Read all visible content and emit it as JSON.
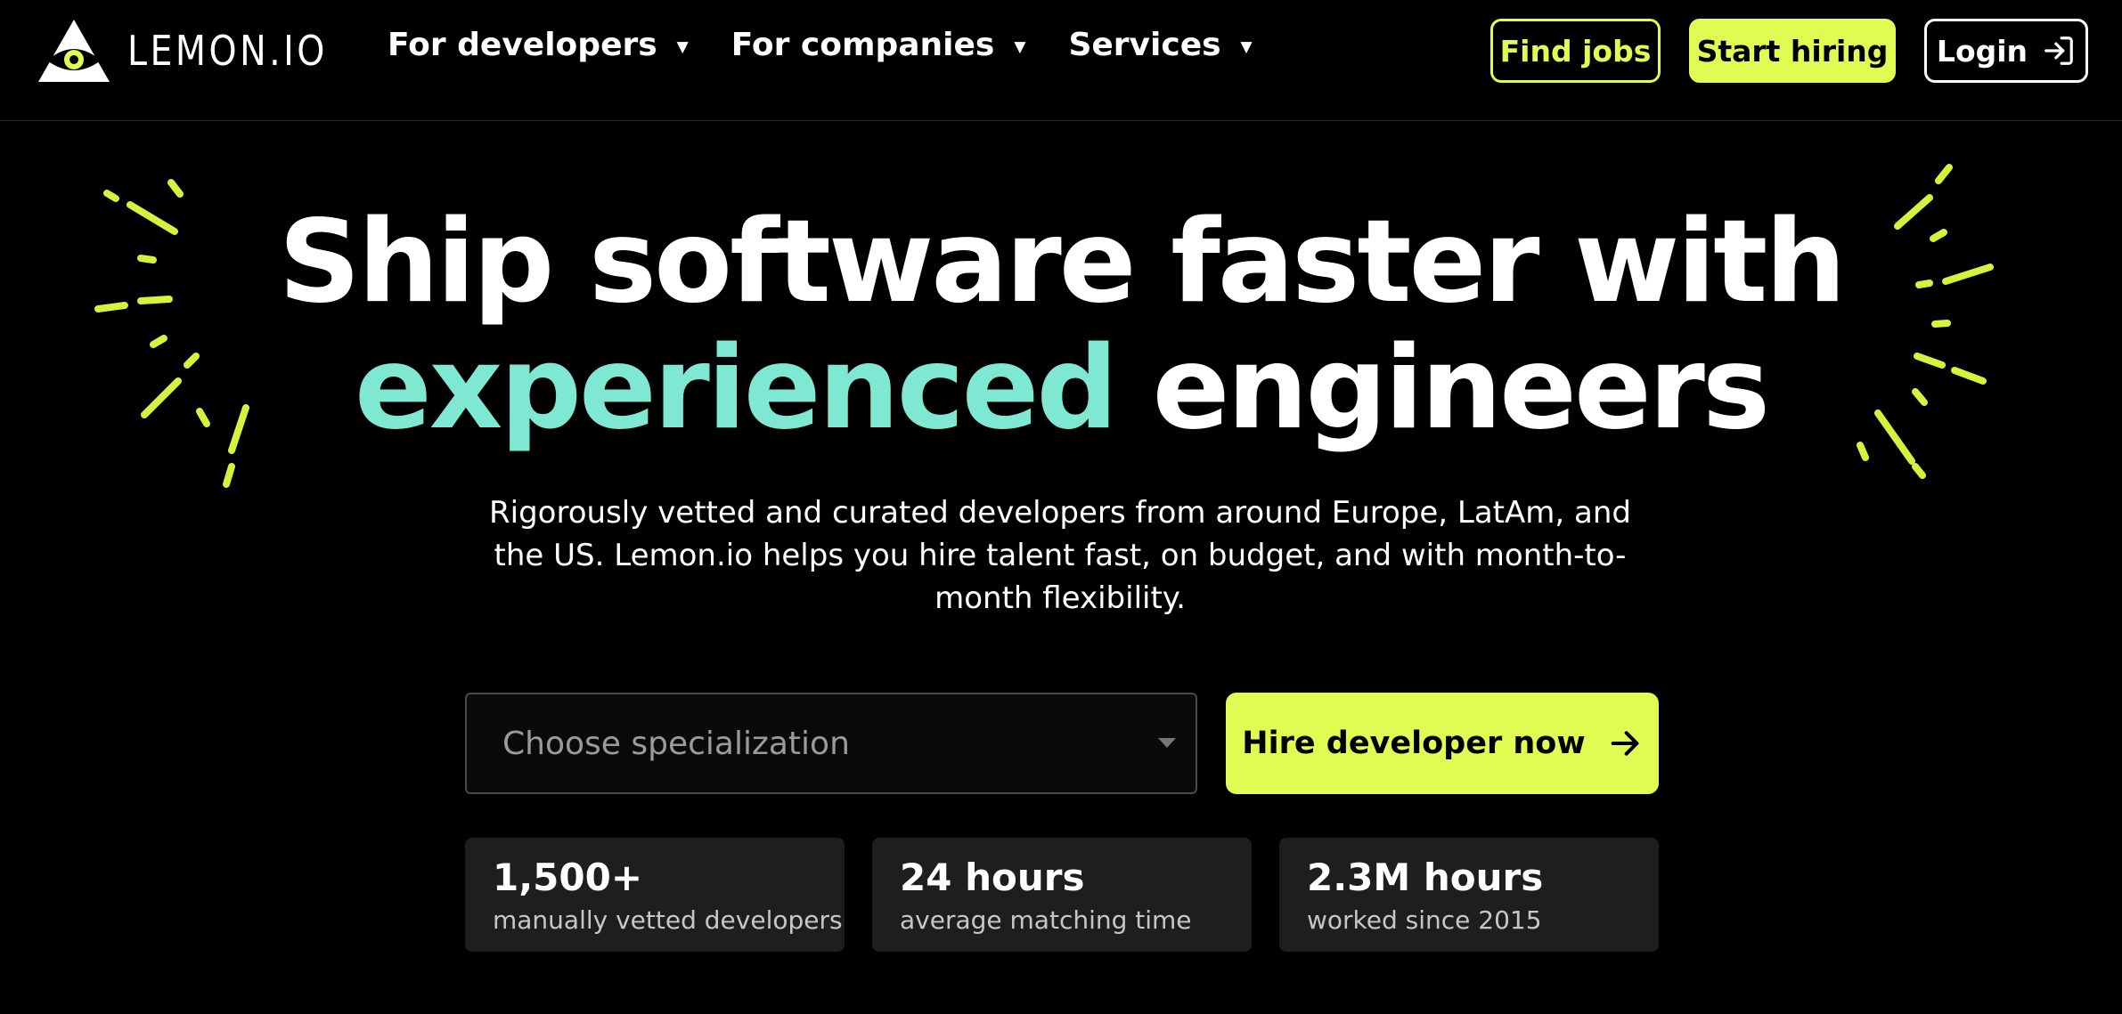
{
  "header": {
    "logo_text": "LEMON.IO",
    "nav": [
      {
        "label": "For developers"
      },
      {
        "label": "For companies"
      },
      {
        "label": "Services"
      }
    ],
    "find_jobs_label": "Find jobs",
    "start_hiring_label": "Start hiring",
    "login_label": "Login"
  },
  "hero": {
    "headline_line1": "Ship software faster with",
    "headline_accent": "experienced",
    "headline_rest": "engineers",
    "subtitle": "Rigorously vetted and curated developers from around Europe, LatAm, and the US. Lemon.io helps you hire talent fast, on budget, and with month-to-month flexibility."
  },
  "form": {
    "specialization_placeholder": "Choose specialization",
    "hire_button_label": "Hire developer now"
  },
  "stats": [
    {
      "value": "1,500+",
      "label": "manually vetted developers"
    },
    {
      "value": "24 hours",
      "label": "average matching time"
    },
    {
      "value": "2.3M hours",
      "label": "worked since 2015"
    }
  ],
  "colors": {
    "background": "#000000",
    "accent_yellow": "#e0fb52",
    "accent_teal": "#7ee8d3",
    "stat_card": "#1e1e1e"
  },
  "icons": {
    "logo": "eye-triangle-icon",
    "dropdown": "caret-down-icon",
    "login": "sign-in-icon",
    "arrow": "arrow-right-icon"
  }
}
